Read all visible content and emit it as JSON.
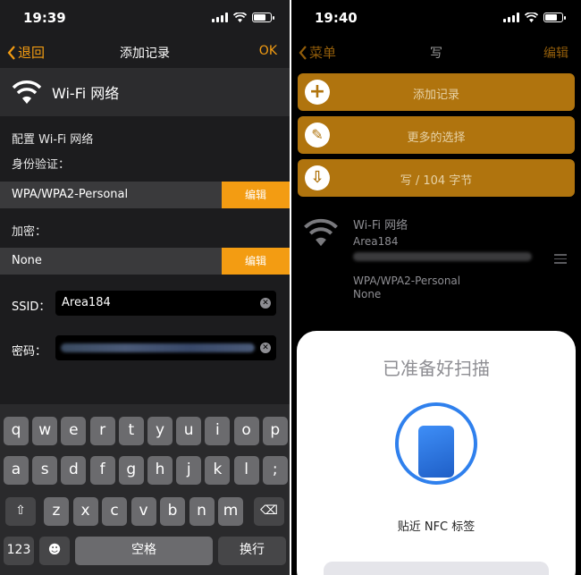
{
  "left": {
    "status": {
      "time": "19:39"
    },
    "nav": {
      "back": "退回",
      "title": "添加记录",
      "action": "OK"
    },
    "header": {
      "title": "Wi-Fi 网络",
      "icon": "wifi-icon"
    },
    "config_label": "配置 Wi-Fi 网络",
    "auth": {
      "label": "身份验证：",
      "value": "WPA/WPA2-Personal",
      "edit": "编辑"
    },
    "encryption": {
      "label": "加密：",
      "value": "None",
      "edit": "编辑"
    },
    "ssid": {
      "label": "SSID：",
      "value": "Area184"
    },
    "password": {
      "label": "密码："
    },
    "keyboard": {
      "row1": [
        "q",
        "w",
        "e",
        "r",
        "t",
        "y",
        "u",
        "i",
        "o",
        "p"
      ],
      "row2": [
        "a",
        "s",
        "d",
        "f",
        "g",
        "h",
        "j",
        "k",
        "l",
        ";"
      ],
      "row3": [
        "z",
        "x",
        "c",
        "v",
        "b",
        "n",
        "m"
      ],
      "shift": "⇧",
      "backspace": "⌫",
      "num": "123",
      "emoji": "☻",
      "space": "空格",
      "return": "换行"
    }
  },
  "right": {
    "status": {
      "time": "19:40"
    },
    "nav": {
      "back": "菜单",
      "title": "写",
      "action": "编辑"
    },
    "buttons": {
      "add": "添加记录",
      "more": "更多的选择",
      "write": "写 / 104 字节"
    },
    "record": {
      "title": "Wi-Fi 网络",
      "ssid": "Area184",
      "auth": "WPA/WPA2-Personal",
      "encryption": "None"
    },
    "sheet": {
      "title": "已准备好扫描",
      "subtitle": "贴近 NFC 标签"
    }
  },
  "colors": {
    "accent": "#f39c12",
    "accent_dim": "#b0740e",
    "nfc_blue": "#2f80ed"
  }
}
